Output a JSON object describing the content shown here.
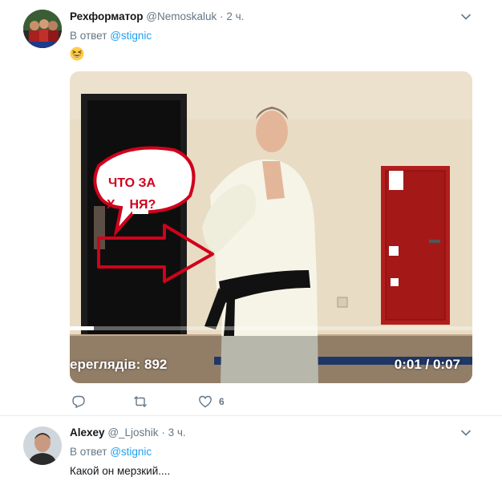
{
  "tweets": [
    {
      "name": "Рехформатор",
      "handle": "@Nemoskaluk",
      "separator": "·",
      "time": "2 ч.",
      "reply_prefix": "В ответ",
      "reply_to": "@stignic",
      "emoji": "grinning-squinting-face",
      "video": {
        "caption_line1": "ЧТО ЗА",
        "caption_line2": "Х    НЯ?",
        "views": "ереглядів: 892",
        "time": "0:01 / 0:07",
        "progress": 0.14
      },
      "actions": {
        "reply_count": "",
        "retweet_count": "",
        "like_count": "6"
      }
    },
    {
      "name": "Alexey",
      "handle": "@_Ljoshik",
      "separator": "·",
      "time": "3 ч.",
      "reply_prefix": "В ответ",
      "reply_to": "@stignic",
      "text": "Какой он мерзкий...."
    }
  ],
  "colors": {
    "link": "#1da1f2",
    "muted": "#657786",
    "caption_red": "#d0021b"
  }
}
